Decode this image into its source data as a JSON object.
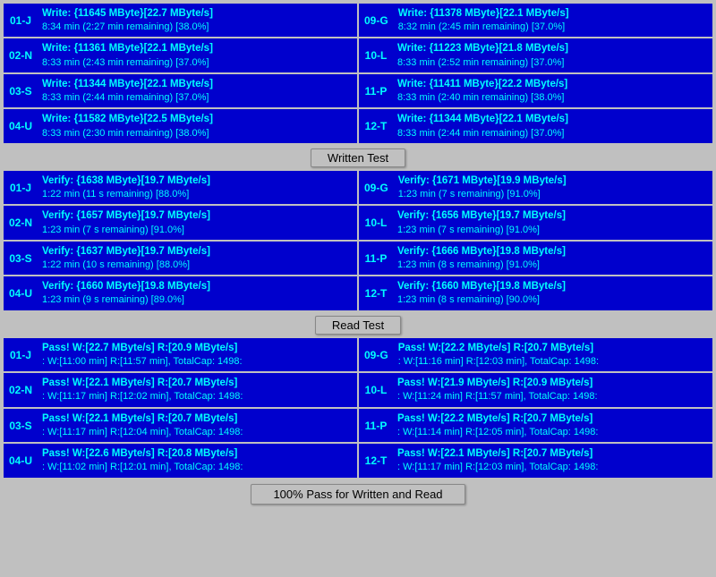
{
  "sections": {
    "write": {
      "rows": [
        {
          "left": {
            "label": "01-J",
            "line1": "Write: {11645 MByte}[22.7 MByte/s]",
            "line2": "8:34 min (2:27 min remaining)  [38.0%]"
          },
          "right": {
            "label": "09-G",
            "line1": "Write: {11378 MByte}[22.1 MByte/s]",
            "line2": "8:32 min (2:45 min remaining)  [37.0%]"
          }
        },
        {
          "left": {
            "label": "02-N",
            "line1": "Write: {11361 MByte}[22.1 MByte/s]",
            "line2": "8:33 min (2:43 min remaining)  [37.0%]"
          },
          "right": {
            "label": "10-L",
            "line1": "Write: {11223 MByte}[21.8 MByte/s]",
            "line2": "8:33 min (2:52 min remaining)  [37.0%]"
          }
        },
        {
          "left": {
            "label": "03-S",
            "line1": "Write: {11344 MByte}[22.1 MByte/s]",
            "line2": "8:33 min (2:44 min remaining)  [37.0%]"
          },
          "right": {
            "label": "11-P",
            "line1": "Write: {11411 MByte}[22.2 MByte/s]",
            "line2": "8:33 min (2:40 min remaining)  [38.0%]"
          }
        },
        {
          "left": {
            "label": "04-U",
            "line1": "Write: {11582 MByte}[22.5 MByte/s]",
            "line2": "8:33 min (2:30 min remaining)  [38.0%]"
          },
          "right": {
            "label": "12-T",
            "line1": "Write: {11344 MByte}[22.1 MByte/s]",
            "line2": "8:33 min (2:44 min remaining)  [37.0%]"
          }
        }
      ],
      "divider": "Written Test"
    },
    "verify": {
      "rows": [
        {
          "left": {
            "label": "01-J",
            "line1": "Verify: {1638 MByte}[19.7 MByte/s]",
            "line2": "1:22 min (11 s remaining)   [88.0%]"
          },
          "right": {
            "label": "09-G",
            "line1": "Verify: {1671 MByte}[19.9 MByte/s]",
            "line2": "1:23 min (7 s remaining)   [91.0%]"
          }
        },
        {
          "left": {
            "label": "02-N",
            "line1": "Verify: {1657 MByte}[19.7 MByte/s]",
            "line2": "1:23 min (7 s remaining)   [91.0%]"
          },
          "right": {
            "label": "10-L",
            "line1": "Verify: {1656 MByte}[19.7 MByte/s]",
            "line2": "1:23 min (7 s remaining)   [91.0%]"
          }
        },
        {
          "left": {
            "label": "03-S",
            "line1": "Verify: {1637 MByte}[19.7 MByte/s]",
            "line2": "1:22 min (10 s remaining)   [88.0%]"
          },
          "right": {
            "label": "11-P",
            "line1": "Verify: {1666 MByte}[19.8 MByte/s]",
            "line2": "1:23 min (8 s remaining)   [91.0%]"
          }
        },
        {
          "left": {
            "label": "04-U",
            "line1": "Verify: {1660 MByte}[19.8 MByte/s]",
            "line2": "1:23 min (9 s remaining)   [89.0%]"
          },
          "right": {
            "label": "12-T",
            "line1": "Verify: {1660 MByte}[19.8 MByte/s]",
            "line2": "1:23 min (8 s remaining)   [90.0%]"
          }
        }
      ],
      "divider": "Read Test"
    },
    "pass": {
      "rows": [
        {
          "left": {
            "label": "01-J",
            "line1": "Pass! W:[22.7 MByte/s] R:[20.9 MByte/s]",
            "line2": ": W:[11:00 min] R:[11:57 min], TotalCap: 1498:"
          },
          "right": {
            "label": "09-G",
            "line1": "Pass! W:[22.2 MByte/s] R:[20.7 MByte/s]",
            "line2": ": W:[11:16 min] R:[12:03 min], TotalCap: 1498:"
          }
        },
        {
          "left": {
            "label": "02-N",
            "line1": "Pass! W:[22.1 MByte/s] R:[20.7 MByte/s]",
            "line2": ": W:[11:17 min] R:[12:02 min], TotalCap: 1498:"
          },
          "right": {
            "label": "10-L",
            "line1": "Pass! W:[21.9 MByte/s] R:[20.9 MByte/s]",
            "line2": ": W:[11:24 min] R:[11:57 min], TotalCap: 1498:"
          }
        },
        {
          "left": {
            "label": "03-S",
            "line1": "Pass! W:[22.1 MByte/s] R:[20.7 MByte/s]",
            "line2": ": W:[11:17 min] R:[12:04 min], TotalCap: 1498:"
          },
          "right": {
            "label": "11-P",
            "line1": "Pass! W:[22.2 MByte/s] R:[20.7 MByte/s]",
            "line2": ": W:[11:14 min] R:[12:05 min], TotalCap: 1498:"
          }
        },
        {
          "left": {
            "label": "04-U",
            "line1": "Pass! W:[22.6 MByte/s] R:[20.8 MByte/s]",
            "line2": ": W:[11:02 min] R:[12:01 min], TotalCap: 1498:"
          },
          "right": {
            "label": "12-T",
            "line1": "Pass! W:[22.1 MByte/s] R:[20.7 MByte/s]",
            "line2": ": W:[11:17 min] R:[12:03 min], TotalCap: 1498:"
          }
        }
      ],
      "footer": "100% Pass for Written and Read"
    }
  }
}
